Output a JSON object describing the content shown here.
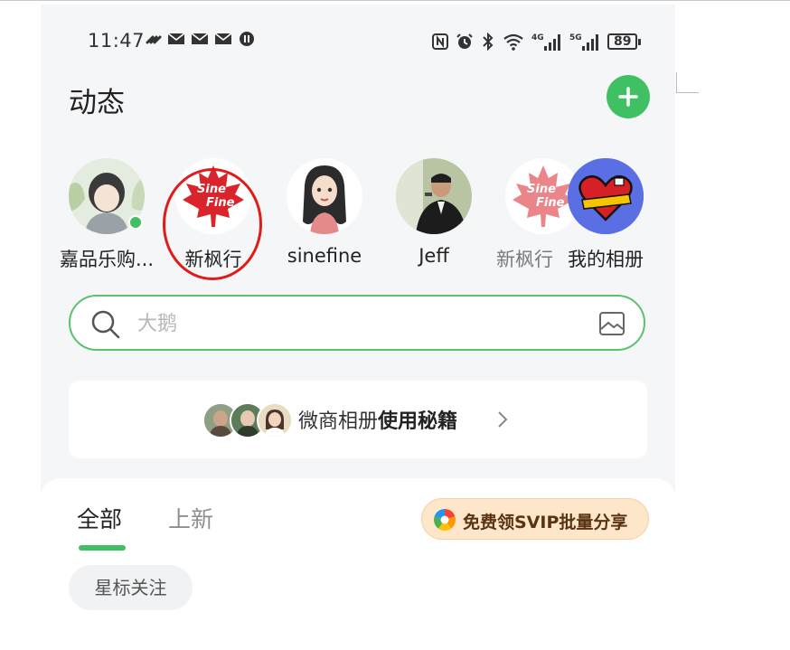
{
  "status_bar": {
    "time": "11:47",
    "battery": "89"
  },
  "header": {
    "title": "动态"
  },
  "stories": [
    {
      "name": "嘉品乐购..."
    },
    {
      "name": "新枫行"
    },
    {
      "name": "sinefine"
    },
    {
      "name": "Jeff"
    },
    {
      "name": "新枫行"
    },
    {
      "name": "我的相册"
    }
  ],
  "logo_text": {
    "line1": "Sine",
    "line2": "Fine"
  },
  "search": {
    "placeholder": "大鹅"
  },
  "tips": {
    "prefix": "微商相册",
    "bold": "使用秘籍"
  },
  "tabs": [
    {
      "label": "全部",
      "active": true
    },
    {
      "label": "上新",
      "active": false
    }
  ],
  "promo": {
    "label": "免费领SVIP批量分享"
  },
  "filters": {
    "star": "星标关注"
  },
  "colors": {
    "accent": "#3fc063",
    "highlight": "#e01b1b",
    "promo_bg": "#fde6c9"
  }
}
